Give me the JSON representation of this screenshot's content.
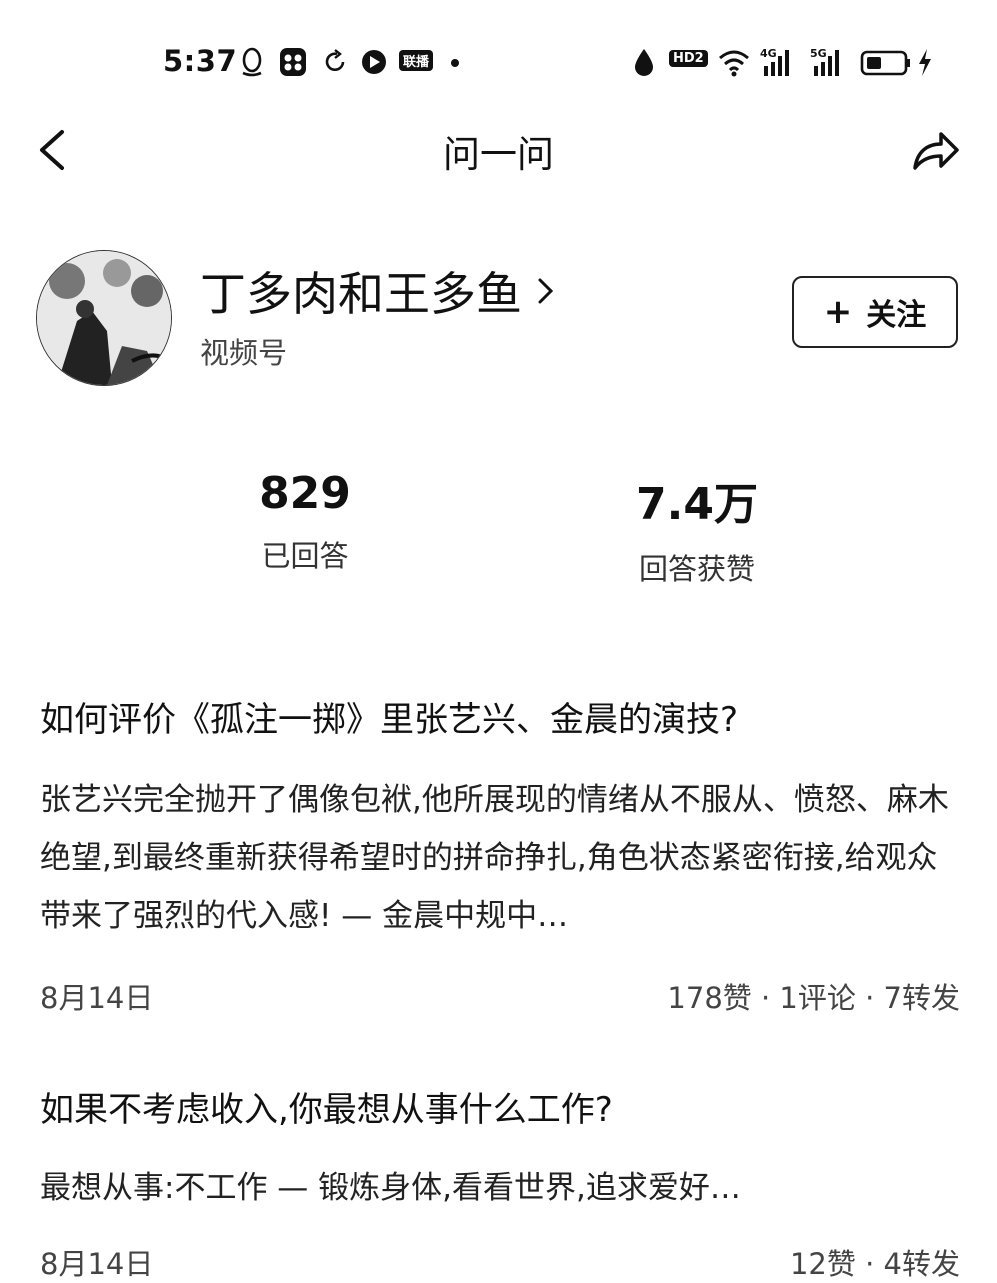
{
  "status_bar": {
    "time": "5:37",
    "icons_left": [
      "qq-icon",
      "app-icon",
      "sync-icon",
      "video-icon",
      "hd-badge-icon",
      "dot-icon"
    ],
    "badge_label": "联播",
    "icons_right": [
      "water-drop-icon",
      "hd2-icon",
      "wifi-icon",
      "signal-4g-icon",
      "signal-5g-icon",
      "battery-icon",
      "charging-icon"
    ],
    "hd_label": "HD2",
    "net1": "4G",
    "net2": "5G"
  },
  "nav": {
    "title": "问一问",
    "back_icon": "back-arrow-icon",
    "share_icon": "share-icon"
  },
  "profile": {
    "name": "丁多肉和王多鱼",
    "subtitle": "视频号",
    "follow_label": "关注",
    "follow_icon": "+"
  },
  "stats": [
    {
      "value": "829",
      "label": "已回答"
    },
    {
      "value": "7.4万",
      "label": "回答获赞"
    }
  ],
  "posts": [
    {
      "question": "如何评价《孤注一掷》里张艺兴、金晨的演技?",
      "answer": "张艺兴完全抛开了偶像包袱,他所展现的情绪从不服从、愤怒、麻木绝望,到最终重新获得希望时的拼命挣扎,角色状态紧密衔接,给观众带来了强烈的代入感! — 金晨中规中…",
      "date": "8月14日",
      "stats": "178赞 · 1评论 · 7转发"
    },
    {
      "question": "如果不考虑收入,你最想从事什么工作?",
      "answer": "最想从事:不工作 — 锻炼身体,看看世界,追求爱好…",
      "date": "8月14日",
      "stats": "12赞 · 4转发"
    }
  ]
}
